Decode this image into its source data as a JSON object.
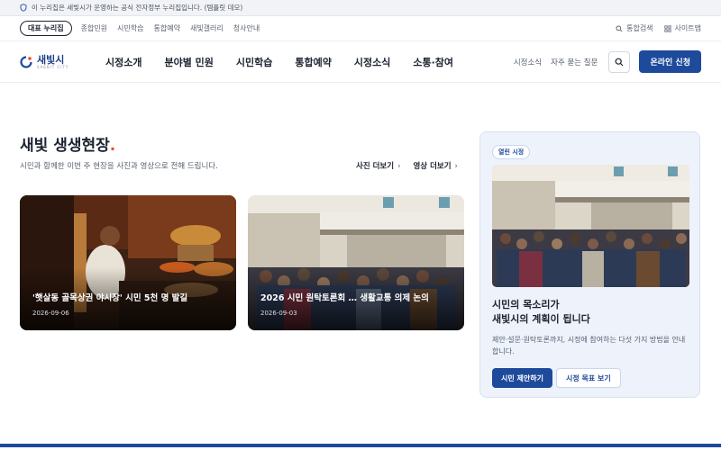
{
  "gov_banner": {
    "text": "이 누리집은 새빛시가 운영하는 공식 전자정부 누리집입니다. (템플릿 데모)"
  },
  "util_bar": {
    "rep_label": "대표 누리집",
    "links": [
      "종합민원",
      "시민학습",
      "통합예약",
      "새빛갤러리",
      "청사안내"
    ],
    "search_label": "통합검색",
    "sitemap_label": "사이트맵"
  },
  "header": {
    "logo_name": "새빛시",
    "logo_sub": "SAEBIT CITY",
    "menu": [
      "시정소개",
      "분야별 민원",
      "시민학습",
      "통합예약",
      "시정소식",
      "소통·참여"
    ],
    "link_news": "시정소식",
    "link_faq": "자주 묻는 질문",
    "apply_label": "온라인 신청"
  },
  "section": {
    "title": "새빛 생생현장",
    "title_dot": ".",
    "desc": "시민과 함께한 이번 주 현장을 사진과 영상으로 전해 드립니다.",
    "more_photos": "사진 더보기",
    "more_videos": "영상 더보기"
  },
  "cards": [
    {
      "caption": "'햇살동 골목상권 야시장' 시민 5천 명 발길",
      "date": "2026-09-06"
    },
    {
      "caption": "2026 시민 원탁토론회 … 생활교통 의제 논의",
      "date": "2026-09-03"
    }
  ],
  "panel": {
    "badge": "열린 시정",
    "title_line1": "시민의 목소리가",
    "title_line2": "새빛시의 계획이 됩니다",
    "desc": "제안·설문·원탁토론까지, 시정에 참여하는 다섯 가지 방법을 안내합니다.",
    "btn_primary": "시민 제안하기",
    "btn_secondary": "시정 목표 보기"
  },
  "colors": {
    "brand": "#1d4a9b",
    "accent_dot": "#e2531b",
    "panel_bg": "#edf2fb"
  }
}
